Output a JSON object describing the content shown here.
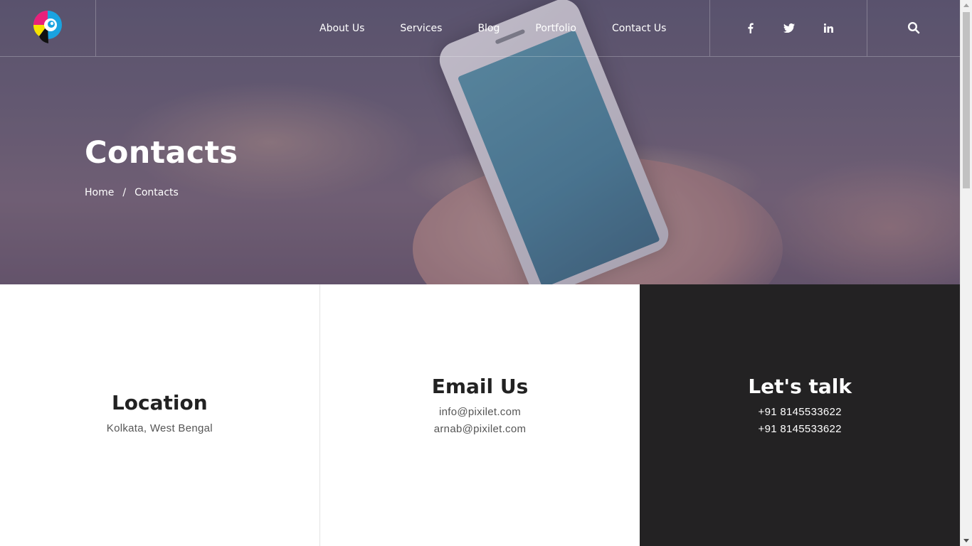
{
  "brand": {
    "logo_icon": "pixilet-logo-icon",
    "colors": {
      "cyan": "#1aa3e0",
      "magenta": "#e8207a",
      "yellow": "#f6e200",
      "black": "#111111"
    }
  },
  "nav": {
    "items": [
      {
        "label": "About Us"
      },
      {
        "label": "Services"
      },
      {
        "label": "Blog"
      },
      {
        "label": "Portfolio"
      },
      {
        "label": "Contact Us"
      }
    ]
  },
  "social": {
    "icons": [
      "facebook-icon",
      "twitter-icon",
      "linkedin-icon"
    ]
  },
  "search": {
    "icon": "search-icon"
  },
  "hero": {
    "title": "Contacts",
    "breadcrumb": {
      "home": "Home",
      "separator": "/",
      "current": "Contacts"
    }
  },
  "contact": {
    "location": {
      "title": "Location",
      "lines": [
        "Kolkata, West Bengal"
      ]
    },
    "email": {
      "title": "Email Us",
      "lines": [
        "info@pixilet.com",
        "arnab@pixilet.com"
      ]
    },
    "talk": {
      "title": "Let's talk",
      "lines": [
        "+91 8145533622",
        "+91 8145533622"
      ],
      "bg_color": "#232223"
    }
  }
}
